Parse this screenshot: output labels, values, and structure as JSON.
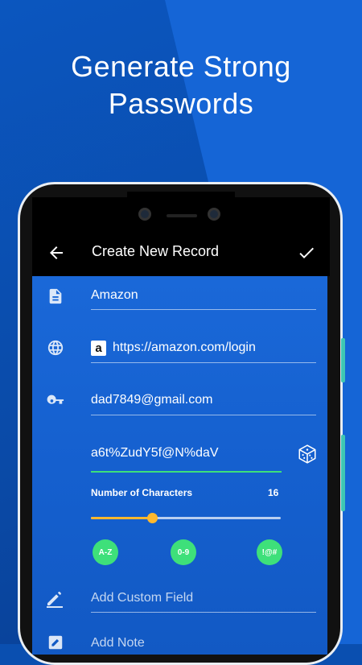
{
  "headline": {
    "line1": "Generate Strong",
    "line2": "Passwords"
  },
  "appbar": {
    "title": "Create New Record"
  },
  "fields": {
    "name": "Amazon",
    "url_badge": "a",
    "url": "https://amazon.com/login",
    "login": "dad7849@gmail.com",
    "password": "a6t%ZudY5f@N%daV"
  },
  "generator": {
    "length_label": "Number of Characters",
    "length_value": "16",
    "slider_level": 0.32,
    "options": [
      "A-Z",
      "0-9",
      "!@#"
    ]
  },
  "custom_field": {
    "placeholder": "Add Custom Field"
  },
  "note": {
    "placeholder": "Add Note"
  },
  "colors": {
    "accent_green": "#3ee07a",
    "slider": "#ffb82e",
    "screen": "#1560cf"
  }
}
